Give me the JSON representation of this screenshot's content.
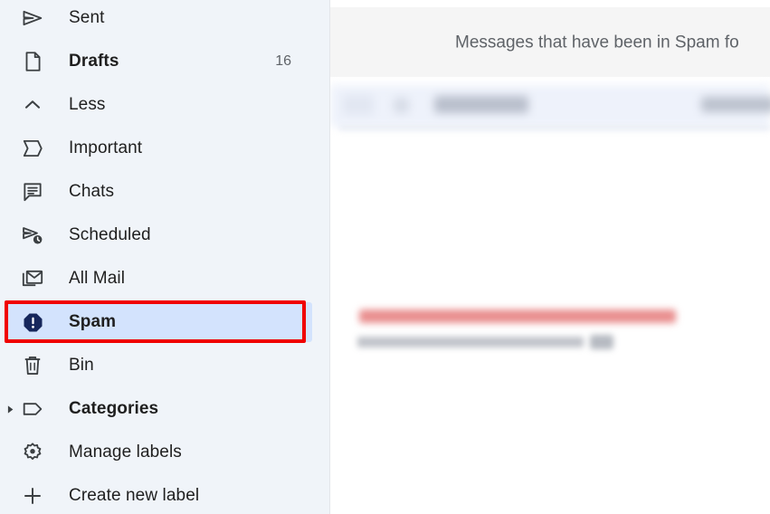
{
  "sidebar": {
    "items": [
      {
        "label": "Sent",
        "icon": "send-icon",
        "count": "",
        "bold": false,
        "selected": false,
        "expander": false
      },
      {
        "label": "Drafts",
        "icon": "draft-document-icon",
        "count": "16",
        "bold": true,
        "selected": false,
        "expander": false
      },
      {
        "label": "Less",
        "icon": "chevron-up-icon",
        "count": "",
        "bold": false,
        "selected": false,
        "expander": false
      },
      {
        "label": "Important",
        "icon": "important-marker-icon",
        "count": "",
        "bold": false,
        "selected": false,
        "expander": false
      },
      {
        "label": "Chats",
        "icon": "chat-bubble-icon",
        "count": "",
        "bold": false,
        "selected": false,
        "expander": false
      },
      {
        "label": "Scheduled",
        "icon": "scheduled-send-icon",
        "count": "",
        "bold": false,
        "selected": false,
        "expander": false
      },
      {
        "label": "All Mail",
        "icon": "all-mail-icon",
        "count": "",
        "bold": false,
        "selected": false,
        "expander": false
      },
      {
        "label": "Spam",
        "icon": "spam-warning-icon",
        "count": "",
        "bold": true,
        "selected": true,
        "expander": false
      },
      {
        "label": "Bin",
        "icon": "trash-bin-icon",
        "count": "",
        "bold": false,
        "selected": false,
        "expander": false
      },
      {
        "label": "Categories",
        "icon": "label-tag-icon",
        "count": "",
        "bold": true,
        "selected": false,
        "expander": true
      },
      {
        "label": "Manage labels",
        "icon": "gear-icon",
        "count": "",
        "bold": false,
        "selected": false,
        "expander": false
      },
      {
        "label": "Create new label",
        "icon": "plus-icon",
        "count": "",
        "bold": false,
        "selected": false,
        "expander": false
      }
    ]
  },
  "content": {
    "banner_text": "Messages that have been in Spam fo"
  },
  "colors": {
    "sidebar_background": "#f0f4f9",
    "selected_pill": "#d3e3fd",
    "highlight_box": "#f00000",
    "text_primary": "#1f1f1f",
    "text_secondary": "#5f6368",
    "banner_background": "#f5f5f5",
    "redaction_red": "#e98e8e"
  }
}
